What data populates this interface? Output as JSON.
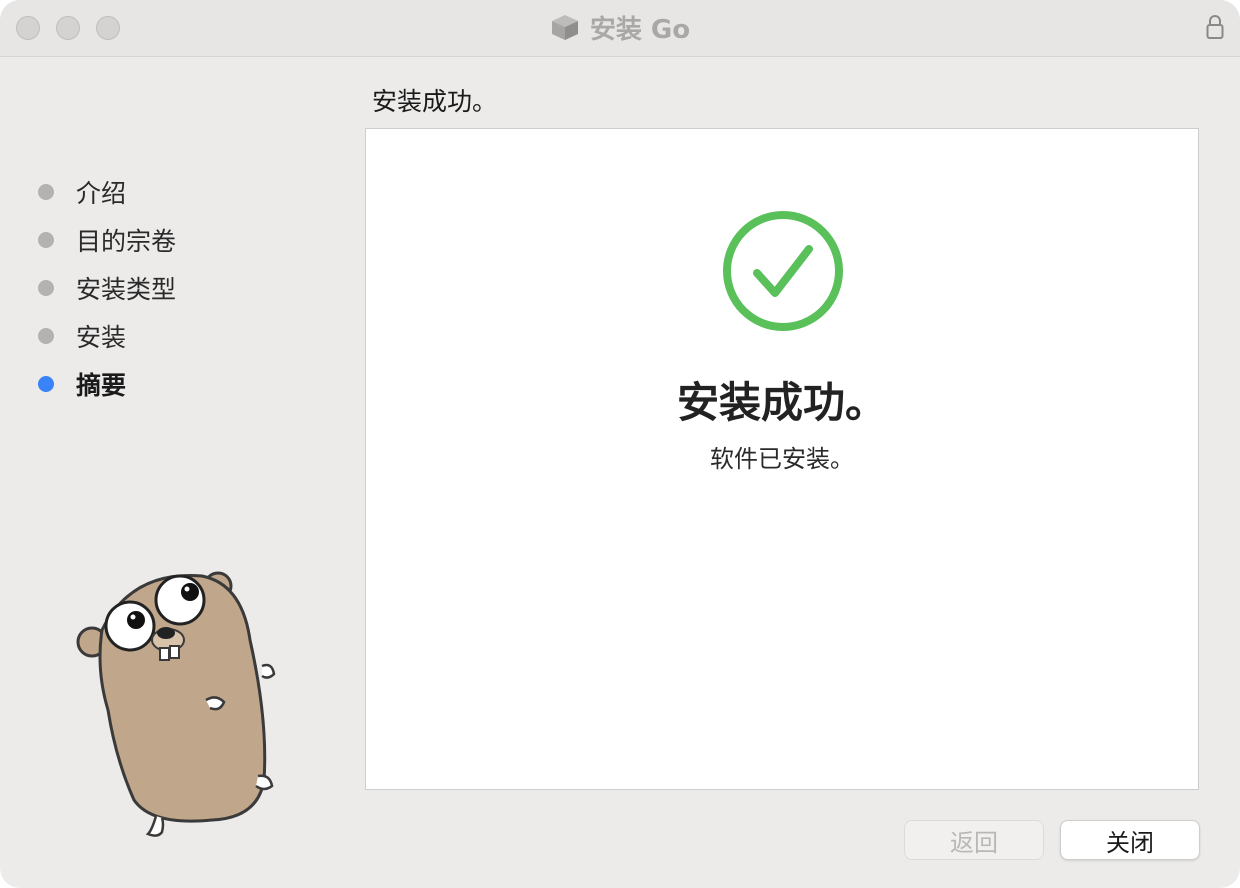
{
  "window": {
    "title": "安装 Go"
  },
  "steps": [
    {
      "label": "介绍",
      "active": false
    },
    {
      "label": "目的宗卷",
      "active": false
    },
    {
      "label": "安装类型",
      "active": false
    },
    {
      "label": "安装",
      "active": false
    },
    {
      "label": "摘要",
      "active": true
    }
  ],
  "header": {
    "title": "安装成功。"
  },
  "content": {
    "headline": "安装成功。",
    "message": "软件已安装。",
    "icon": "checkmark-circle-icon",
    "success_color": "#5ac05a"
  },
  "buttons": {
    "back_label": "返回",
    "close_label": "关闭"
  },
  "colors": {
    "accent": "#3a82f7"
  }
}
